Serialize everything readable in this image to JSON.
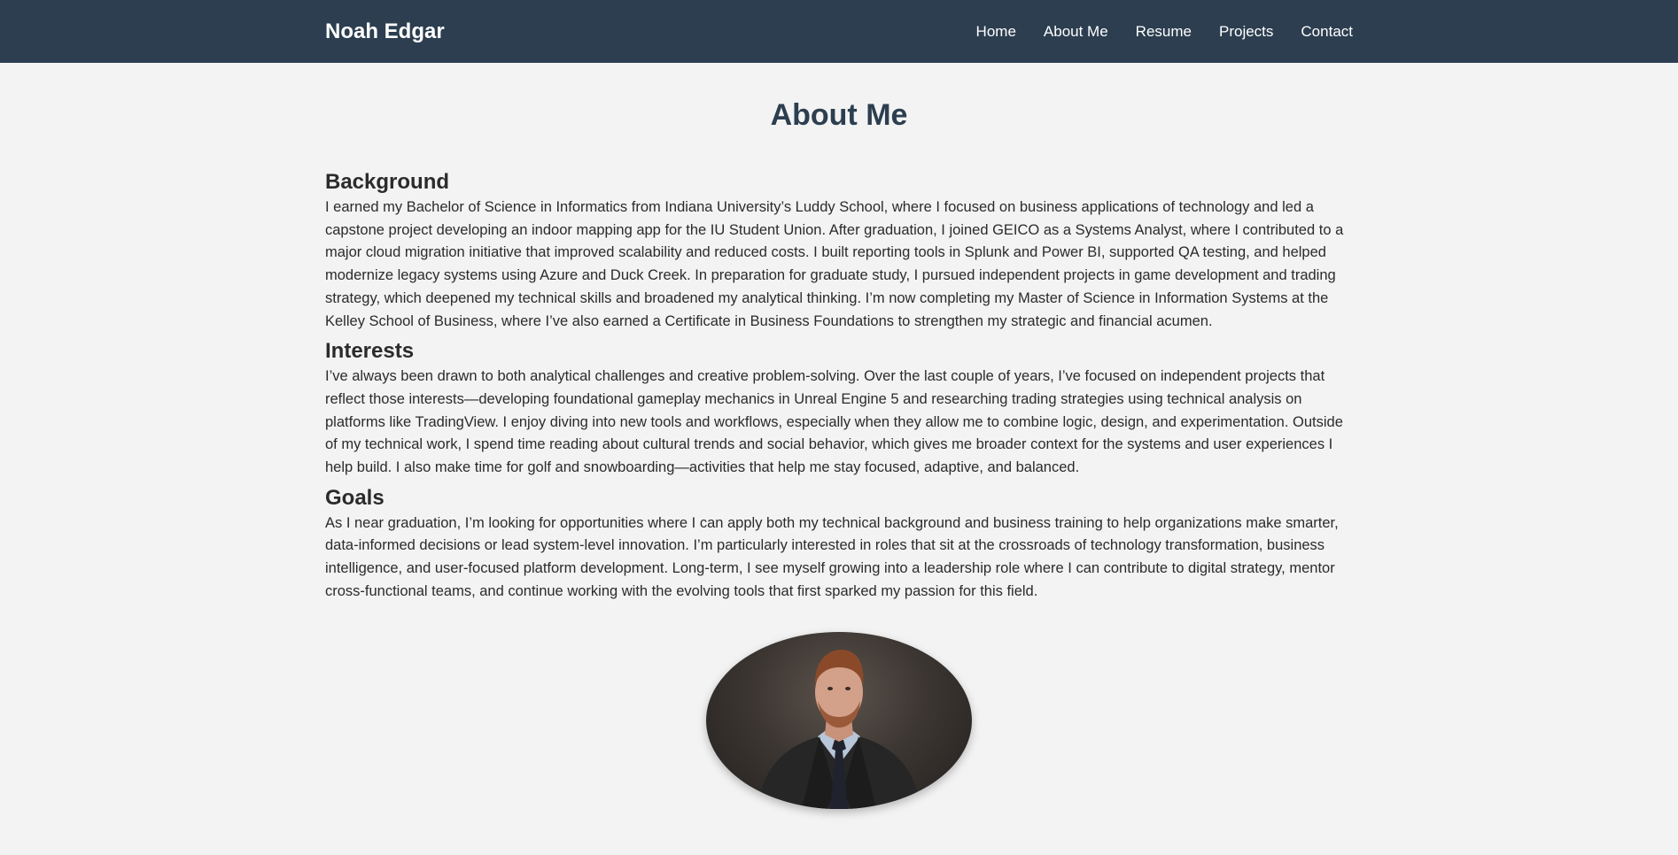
{
  "nav": {
    "brand": "Noah Edgar",
    "links": [
      "Home",
      "About Me",
      "Resume",
      "Projects",
      "Contact"
    ]
  },
  "page_title": "About Me",
  "sections": [
    {
      "heading": "Background",
      "body": "I earned my Bachelor of Science in Informatics from Indiana University’s Luddy School, where I focused on business applications of technology and led a capstone project developing an indoor mapping app for the IU Student Union. After graduation, I joined GEICO as a Systems Analyst, where I contributed to a major cloud migration initiative that improved scalability and reduced costs. I built reporting tools in Splunk and Power BI, supported QA testing, and helped modernize legacy systems using Azure and Duck Creek. In preparation for graduate study, I pursued independent projects in game development and trading strategy, which deepened my technical skills and broadened my analytical thinking. I’m now completing my Master of Science in Information Systems at the Kelley School of Business, where I’ve also earned a Certificate in Business Foundations to strengthen my strategic and financial acumen."
    },
    {
      "heading": "Interests",
      "body": "I’ve always been drawn to both analytical challenges and creative problem-solving. Over the last couple of years, I’ve focused on independent projects that reflect those interests—developing foundational gameplay mechanics in Unreal Engine 5 and researching trading strategies using technical analysis on platforms like TradingView. I enjoy diving into new tools and workflows, especially when they allow me to combine logic, design, and experimentation. Outside of my technical work, I spend time reading about cultural trends and social behavior, which gives me broader context for the systems and user experiences I help build. I also make time for golf and snowboarding—activities that help me stay focused, adaptive, and balanced."
    },
    {
      "heading": "Goals",
      "body": "As I near graduation, I’m looking for opportunities where I can apply both my technical background and business training to help organizations make smarter, data-informed decisions or lead system-level innovation. I’m particularly interested in roles that sit at the crossroads of technology transformation, business intelligence, and user-focused platform development. Long-term, I see myself growing into a leadership role where I can contribute to digital strategy, mentor cross-functional teams, and continue working with the evolving tools that first sparked my passion for this field."
    }
  ],
  "colors": {
    "navbar_bg": "#2c3e50",
    "page_bg": "#f3f3f3",
    "title_color": "#2c3e50",
    "text_color": "#2b2b2b"
  }
}
